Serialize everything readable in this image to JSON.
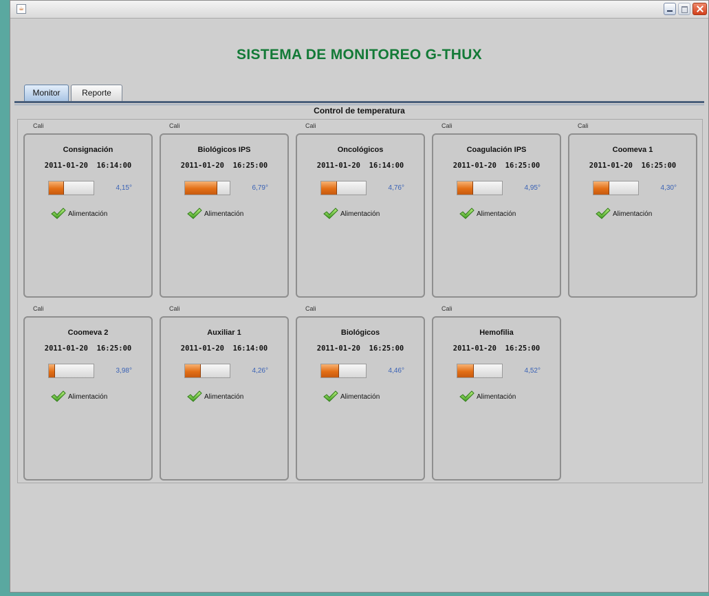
{
  "window": {
    "title": ""
  },
  "app_title": "SISTEMA DE MONITOREO G-THUX",
  "tabs": [
    {
      "label": "Monitor",
      "selected": true
    },
    {
      "label": "Reporte",
      "selected": false
    }
  ],
  "group_title": "Control de temperatura",
  "colors": {
    "title_green": "#137a37",
    "bar_orange": "#e36f16",
    "temp_blue": "#3a62b5",
    "check_green": "#5cc23a"
  },
  "units": [
    {
      "city": "Cali",
      "name": "Consignación",
      "date": "2011-01-20",
      "time": "16:14:00",
      "level": 0.33,
      "temperature": "4,15°",
      "power_label": "Alimentación",
      "power_ok": true
    },
    {
      "city": "Cali",
      "name": "Biológicos IPS",
      "date": "2011-01-20",
      "time": "16:25:00",
      "level": 0.7,
      "temperature": "6,79°",
      "power_label": "Alimentación",
      "power_ok": true
    },
    {
      "city": "Cali",
      "name": "Oncológicos",
      "date": "2011-01-20",
      "time": "16:14:00",
      "level": 0.34,
      "temperature": "4,76°",
      "power_label": "Alimentación",
      "power_ok": true
    },
    {
      "city": "Cali",
      "name": "Coagulación IPS",
      "date": "2011-01-20",
      "time": "16:25:00",
      "level": 0.34,
      "temperature": "4,95°",
      "power_label": "Alimentación",
      "power_ok": true
    },
    {
      "city": "Cali",
      "name": "Coomeva 1",
      "date": "2011-01-20",
      "time": "16:25:00",
      "level": 0.34,
      "temperature": "4,30°",
      "power_label": "Alimentación",
      "power_ok": true
    },
    {
      "city": "Cali",
      "name": "Coomeva 2",
      "date": "2011-01-20",
      "time": "16:25:00",
      "level": 0.12,
      "temperature": "3,98°",
      "power_label": "Alimentación",
      "power_ok": true
    },
    {
      "city": "Cali",
      "name": "Auxiliar 1",
      "date": "2011-01-20",
      "time": "16:14:00",
      "level": 0.34,
      "temperature": "4,26°",
      "power_label": "Alimentación",
      "power_ok": true
    },
    {
      "city": "Cali",
      "name": "Biológicos",
      "date": "2011-01-20",
      "time": "16:25:00",
      "level": 0.38,
      "temperature": "4,46°",
      "power_label": "Alimentación",
      "power_ok": true
    },
    {
      "city": "Cali",
      "name": "Hemofilia",
      "date": "2011-01-20",
      "time": "16:25:00",
      "level": 0.36,
      "temperature": "4,52°",
      "power_label": "Alimentación",
      "power_ok": true
    }
  ]
}
